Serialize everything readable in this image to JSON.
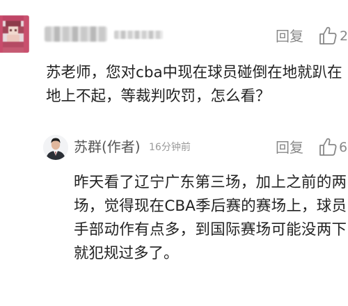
{
  "comment": {
    "body": "苏老师，您对cba中现在球员碰倒在地就趴在地上不起，等裁判吹罚，怎么看？",
    "reply_label": "回复",
    "like_count": "2",
    "like_icon": "thumbs-up-outline-icon"
  },
  "reply": {
    "author": "苏群(作者)",
    "time": "16分钟前",
    "reply_label": "回复",
    "like_count": "6",
    "like_icon": "thumbs-up-outline-icon",
    "body": "昨天看了辽宁广东第三场，加上之前的两场，觉得现在CBA季后赛的赛场上，球员手部动作有点多，到国际赛场可能没两下就犯规过多了。"
  },
  "colors": {
    "text": "#222222",
    "meta": "#888888",
    "timestamp": "#9a9a9a"
  }
}
